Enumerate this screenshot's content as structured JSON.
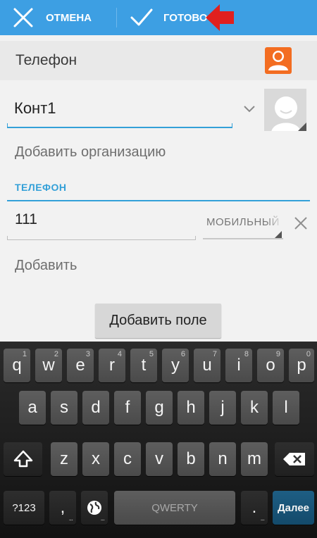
{
  "topbar": {
    "cancel_label": "ОТМЕНА",
    "done_label": "ГОТОВО",
    "background": "#3d9fe3",
    "annotation_color": "#e0201e"
  },
  "account": {
    "label": "Телефон",
    "icon_color": "#f36d21"
  },
  "contact": {
    "name_value": "Конт1"
  },
  "add_organization_label": "Добавить организацию",
  "phone_section": {
    "title": "ТЕЛЕФОН",
    "number_value": "111",
    "type_value": "МОБИЛЬНЫЙ",
    "accent": "#33a0d8"
  },
  "add_label": "Добавить",
  "add_field_button": "Добавить поле",
  "keyboard": {
    "row1": [
      {
        "ch": "q",
        "num": "1"
      },
      {
        "ch": "w",
        "num": "2"
      },
      {
        "ch": "e",
        "num": "3"
      },
      {
        "ch": "r",
        "num": "4"
      },
      {
        "ch": "t",
        "num": "5"
      },
      {
        "ch": "y",
        "num": "6"
      },
      {
        "ch": "u",
        "num": "7"
      },
      {
        "ch": "i",
        "num": "8"
      },
      {
        "ch": "o",
        "num": "9"
      },
      {
        "ch": "p",
        "num": "0"
      }
    ],
    "row2": [
      "a",
      "s",
      "d",
      "f",
      "g",
      "h",
      "j",
      "k",
      "l"
    ],
    "row3": [
      "z",
      "x",
      "c",
      "v",
      "b",
      "n",
      "m"
    ],
    "symbols_label": "?123",
    "comma_label": ",",
    "space_label": "QWERTY",
    "period_label": ".",
    "enter_label": "Далее",
    "enter_color": "#1a5a80"
  }
}
